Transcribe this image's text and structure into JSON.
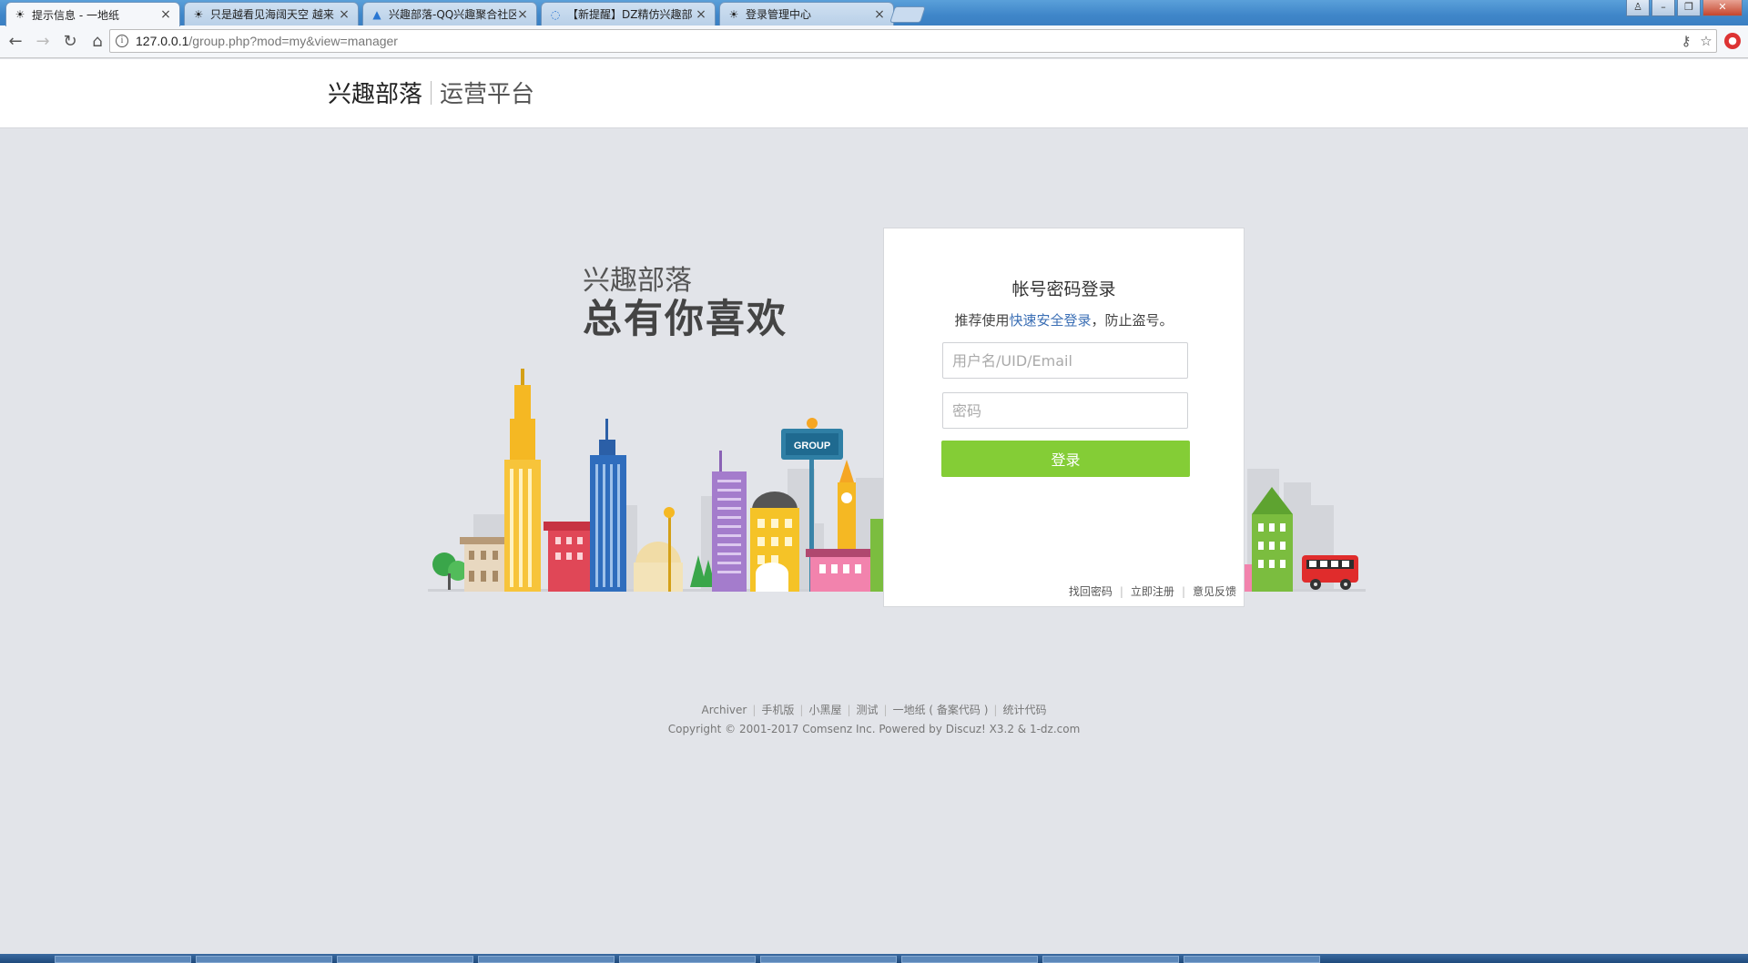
{
  "browser": {
    "tabs": [
      {
        "title": "提示信息 - 一地纸",
        "icon": "sun-icon",
        "active": true
      },
      {
        "title": "只是越看见海阔天空 越来",
        "icon": "sun-icon",
        "active": false
      },
      {
        "title": "兴趣部落-QQ兴趣聚合社区",
        "icon": "triangle-icon",
        "active": false
      },
      {
        "title": "【新提醒】DZ精仿兴趣部",
        "icon": "loading-icon",
        "active": false
      },
      {
        "title": "登录管理中心",
        "icon": "sun-icon",
        "active": false
      }
    ],
    "url_host": "127.0.0.1",
    "url_path": "/group.php?mod=my&view=manager"
  },
  "header": {
    "logo_main": "兴趣部落",
    "logo_sub": "运营平台"
  },
  "hero": {
    "line1": "兴趣部落",
    "line2": "总有你喜欢",
    "sign_text": "GROUP"
  },
  "login": {
    "title": "帐号密码登录",
    "tip_prefix": "推荐使用",
    "tip_link": "快速安全登录",
    "tip_suffix": "，防止盗号。",
    "username_placeholder": "用户名/UID/Email",
    "password_placeholder": "密码",
    "submit_label": "登录",
    "links": [
      "找回密码",
      "立即注册",
      "意见反馈"
    ]
  },
  "footer": {
    "links": [
      "Archiver",
      "手机版",
      "小黑屋",
      "测试",
      "一地纸 ( 备案代码 )",
      "统计代码"
    ],
    "copyright": "Copyright © 2001-2017 Comsenz Inc.  Powered by Discuz! X3.2 & 1-dz.com"
  },
  "colors": {
    "page_bg": "#e2e4e9",
    "accent_green": "#84cd36",
    "link_blue": "#3b6fb5"
  }
}
